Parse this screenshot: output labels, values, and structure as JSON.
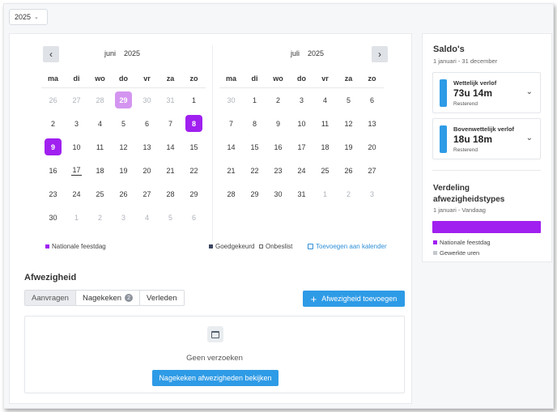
{
  "year_selector": {
    "value": "2025",
    "chevron_icon": "chevron-down-icon"
  },
  "calendars": [
    {
      "month": "juni",
      "year": "2025",
      "nav_icon": "chevron-left-icon",
      "weekdays": [
        "ma",
        "di",
        "wo",
        "do",
        "vr",
        "za",
        "zo"
      ],
      "weeks": [
        [
          {
            "d": "26",
            "muted": true
          },
          {
            "d": "27",
            "muted": true
          },
          {
            "d": "28",
            "muted": true
          },
          {
            "d": "29",
            "muted": true,
            "mark": "light"
          },
          {
            "d": "30",
            "muted": true
          },
          {
            "d": "31",
            "muted": true
          },
          {
            "d": "1"
          }
        ],
        [
          {
            "d": "2"
          },
          {
            "d": "3"
          },
          {
            "d": "4"
          },
          {
            "d": "5"
          },
          {
            "d": "6"
          },
          {
            "d": "7"
          },
          {
            "d": "8",
            "mark": "dark"
          }
        ],
        [
          {
            "d": "9",
            "mark": "dark"
          },
          {
            "d": "10"
          },
          {
            "d": "11"
          },
          {
            "d": "12"
          },
          {
            "d": "13"
          },
          {
            "d": "14"
          },
          {
            "d": "15"
          }
        ],
        [
          {
            "d": "16"
          },
          {
            "d": "17",
            "today": true
          },
          {
            "d": "18"
          },
          {
            "d": "19"
          },
          {
            "d": "20"
          },
          {
            "d": "21"
          },
          {
            "d": "22"
          }
        ],
        [
          {
            "d": "23"
          },
          {
            "d": "24"
          },
          {
            "d": "25"
          },
          {
            "d": "26"
          },
          {
            "d": "27"
          },
          {
            "d": "28"
          },
          {
            "d": "29"
          }
        ],
        [
          {
            "d": "30"
          },
          {
            "d": "1",
            "muted": true
          },
          {
            "d": "2",
            "muted": true
          },
          {
            "d": "3",
            "muted": true
          },
          {
            "d": "4",
            "muted": true
          },
          {
            "d": "5",
            "muted": true
          },
          {
            "d": "6",
            "muted": true
          }
        ]
      ]
    },
    {
      "month": "juli",
      "year": "2025",
      "nav_icon": "chevron-right-icon",
      "weekdays": [
        "ma",
        "di",
        "wo",
        "do",
        "vr",
        "za",
        "zo"
      ],
      "weeks": [
        [
          {
            "d": "30",
            "muted": true
          },
          {
            "d": "1"
          },
          {
            "d": "2"
          },
          {
            "d": "3"
          },
          {
            "d": "4"
          },
          {
            "d": "5"
          },
          {
            "d": "6"
          }
        ],
        [
          {
            "d": "7"
          },
          {
            "d": "8"
          },
          {
            "d": "9"
          },
          {
            "d": "10"
          },
          {
            "d": "11"
          },
          {
            "d": "12"
          },
          {
            "d": "13"
          }
        ],
        [
          {
            "d": "14"
          },
          {
            "d": "15"
          },
          {
            "d": "16"
          },
          {
            "d": "17"
          },
          {
            "d": "18"
          },
          {
            "d": "19"
          },
          {
            "d": "20"
          }
        ],
        [
          {
            "d": "21"
          },
          {
            "d": "22"
          },
          {
            "d": "23"
          },
          {
            "d": "24"
          },
          {
            "d": "25"
          },
          {
            "d": "26"
          },
          {
            "d": "27"
          }
        ],
        [
          {
            "d": "28"
          },
          {
            "d": "29"
          },
          {
            "d": "30"
          },
          {
            "d": "31"
          },
          {
            "d": "1",
            "muted": true
          },
          {
            "d": "2",
            "muted": true
          },
          {
            "d": "3",
            "muted": true
          }
        ]
      ]
    }
  ],
  "legend": {
    "holiday": "Nationale feestdag",
    "approved": "Goedgekeurd",
    "undecided": "Onbeslist",
    "add_to_calendar": "Toevoegen aan kalender"
  },
  "absence": {
    "title": "Afwezigheid",
    "tabs": [
      {
        "label": "Aanvragen",
        "active": true
      },
      {
        "label": "Nagekeken",
        "badge": "2"
      },
      {
        "label": "Verleden"
      }
    ],
    "add_button": "Afwezigheid toevoegen",
    "empty_text": "Geen verzoeken",
    "view_button": "Nagekeken afwezigheden bekijken"
  },
  "sidebar": {
    "title": "Saldo's",
    "subtitle": "1 januari - 31 december",
    "balances": [
      {
        "name": "Wettelijk verlof",
        "value": "73u 14m",
        "desc": "Resterend"
      },
      {
        "name": "Bovenwettelijk verlof",
        "value": "18u 18m",
        "desc": "Resterend"
      }
    ],
    "distribution_title": "Verdeling afwezigheidstypes",
    "distribution_sub": "1 januari - Vandaag",
    "dist_legend": [
      "Nationale feestdag",
      "Gewerkte uren"
    ]
  },
  "colors": {
    "accent": "#2e9be6",
    "holiday": "#a020f0",
    "holiday_light": "#d495f0"
  }
}
